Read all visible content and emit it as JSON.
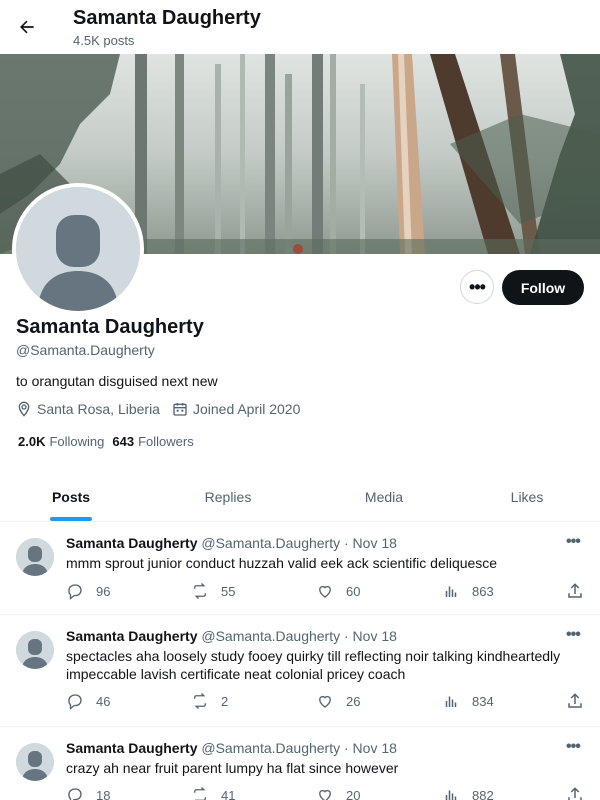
{
  "header": {
    "title": "Samanta Daugherty",
    "posts_count": "4.5K posts"
  },
  "profile": {
    "name": "Samanta Daugherty",
    "handle": "@Samanta.Daugherty",
    "bio": "to orangutan disguised next new",
    "location": "Santa Rosa, Liberia",
    "joined": "Joined April 2020",
    "following_count": "2.0K",
    "following_label": "Following",
    "followers_count": "643",
    "followers_label": "Followers",
    "more_label": "•••",
    "follow_label": "Follow"
  },
  "tabs": [
    {
      "label": "Posts",
      "active": true
    },
    {
      "label": "Replies",
      "active": false
    },
    {
      "label": "Media",
      "active": false
    },
    {
      "label": "Likes",
      "active": false
    }
  ],
  "tweets": [
    {
      "name": "Samanta Daugherty",
      "handle_date": "@Samanta.Daugherty · Nov 18",
      "text": "mmm sprout junior conduct huzzah valid eek ack scientific deliquesce",
      "replies": "96",
      "reposts": "55",
      "likes": "60",
      "views": "863"
    },
    {
      "name": "Samanta Daugherty",
      "handle_date": "@Samanta.Daugherty · Nov 18",
      "text": "spectacles aha loosely study fooey quirky till reflecting noir talking kindheartedly impeccable lavish certificate neat colonial pricey coach",
      "replies": "46",
      "reposts": "2",
      "likes": "26",
      "views": "834"
    },
    {
      "name": "Samanta Daugherty",
      "handle_date": "@Samanta.Daugherty · Nov 18",
      "text": "crazy ah near fruit parent lumpy ha flat since however",
      "replies": "18",
      "reposts": "41",
      "likes": "20",
      "views": "882"
    }
  ],
  "tweet_more_label": "•••",
  "colors": {
    "accent": "#1d9bf0",
    "text": "#0f1419",
    "muted": "#536471"
  }
}
